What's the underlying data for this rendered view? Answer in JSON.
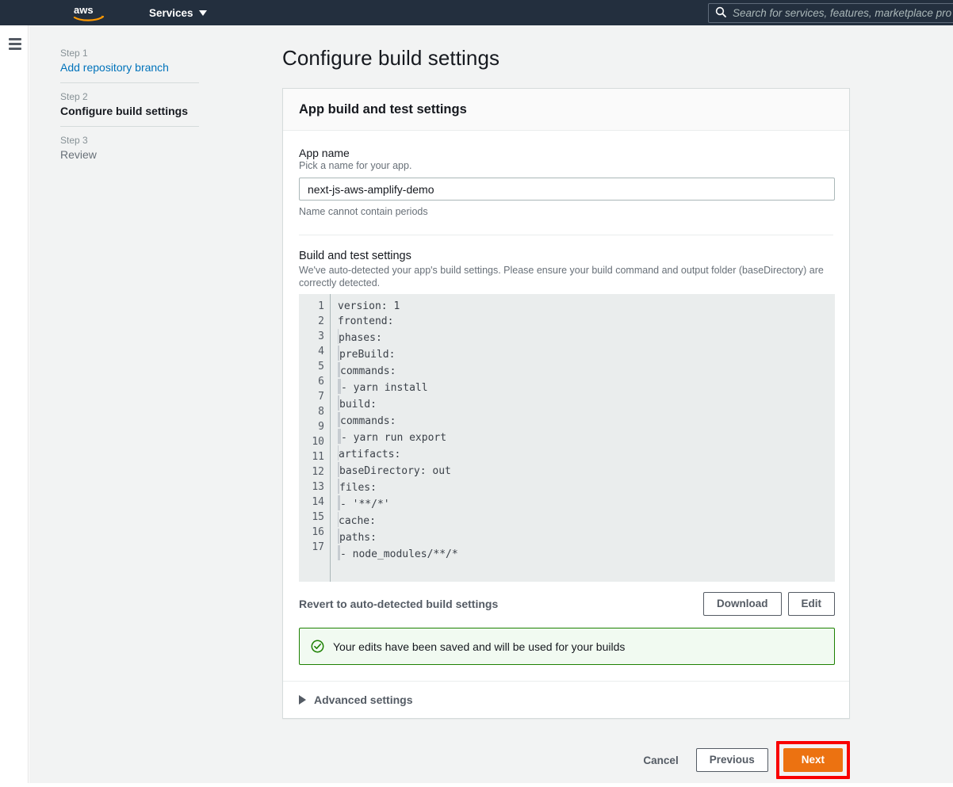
{
  "navbar": {
    "logo_alt": "aws-logo",
    "services_label": "Services",
    "search_placeholder": "Search for services, features, marketplace pro",
    "search_value": ""
  },
  "sidebar": {
    "menu_icon": "hamburger-icon",
    "steps": [
      {
        "number": "Step 1",
        "title": "Add repository branch",
        "state": "completed"
      },
      {
        "number": "Step 2",
        "title": "Configure build settings",
        "state": "current"
      },
      {
        "number": "Step 3",
        "title": "Review",
        "state": "upcoming"
      }
    ]
  },
  "main": {
    "page_title": "Configure build settings",
    "card_title": "App build and test settings",
    "app_name": {
      "label": "App name",
      "hint": "Pick a name for your app.",
      "value": "next-js-aws-amplify-demo",
      "placeholder": "",
      "note": "Name cannot contain periods"
    },
    "build_settings": {
      "label": "Build and test settings",
      "description": "We've auto-detected your app's build settings. Please ensure your build command and output folder (baseDirectory) are correctly detected.",
      "editor_lines": [
        {
          "n": "1",
          "indent": 0,
          "text": "version: 1"
        },
        {
          "n": "2",
          "indent": 0,
          "text": "frontend:"
        },
        {
          "n": "3",
          "indent": 1,
          "text": "phases:"
        },
        {
          "n": "4",
          "indent": 2,
          "text": "preBuild:"
        },
        {
          "n": "5",
          "indent": 3,
          "text": "commands:"
        },
        {
          "n": "6",
          "indent": 4,
          "text": "- yarn install"
        },
        {
          "n": "7",
          "indent": 2,
          "text": "build:"
        },
        {
          "n": "8",
          "indent": 3,
          "text": "commands:"
        },
        {
          "n": "9",
          "indent": 4,
          "text": "- yarn run export"
        },
        {
          "n": "10",
          "indent": 1,
          "text": "artifacts:"
        },
        {
          "n": "11",
          "indent": 2,
          "text": "baseDirectory: out"
        },
        {
          "n": "12",
          "indent": 2,
          "text": "files:"
        },
        {
          "n": "13",
          "indent": 3,
          "text": "- '**/*'"
        },
        {
          "n": "14",
          "indent": 1,
          "text": "cache:"
        },
        {
          "n": "15",
          "indent": 2,
          "text": "paths:"
        },
        {
          "n": "16",
          "indent": 3,
          "text": "- node_modules/**/*"
        },
        {
          "n": "17",
          "indent": 0,
          "text": ""
        }
      ],
      "revert_label": "Revert to auto-detected build settings",
      "download_label": "Download",
      "edit_label": "Edit"
    },
    "alert": {
      "icon": "check-circle-icon",
      "message": "Your edits have been saved and will be used for your builds",
      "border_color": "#1d8102",
      "background_color": "#f1faf1"
    },
    "advanced": {
      "icon": "triangle-right-icon",
      "label": "Advanced settings",
      "expanded": false
    }
  },
  "actions": {
    "cancel_label": "Cancel",
    "previous_label": "Previous",
    "next_label": "Next",
    "next_accent_color": "#ec7211",
    "highlight_color": "#f90000"
  }
}
